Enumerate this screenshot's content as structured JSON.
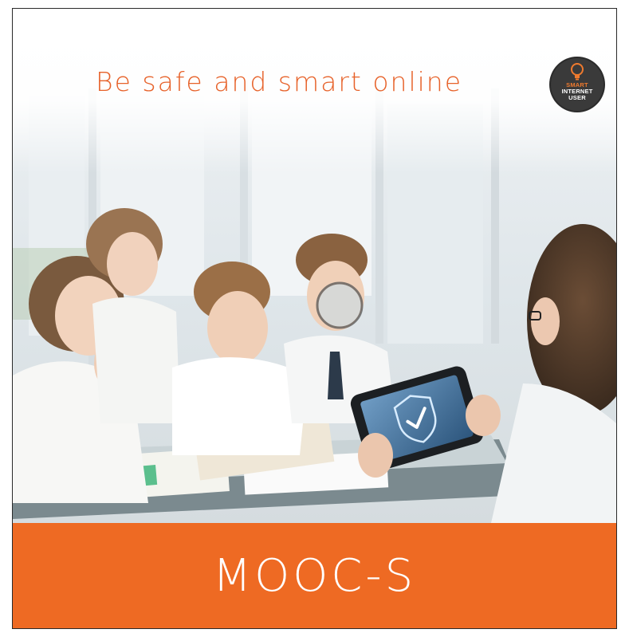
{
  "cover": {
    "headline": "Be safe and smart online",
    "badge": {
      "line1": "SMART",
      "line2": "INTERNET",
      "line3": "USER"
    },
    "brand": "MOOC-S"
  },
  "photo": {
    "subject": "Children gathered around a table looking at a tablet held by a teacher showing a shield with a check mark",
    "tablet_icon": "shield-check-icon"
  },
  "colors": {
    "accent": "#ee6a23",
    "headline": "#e7622a",
    "badge_bg": "#3a3a3a",
    "tablet_screen": "#3f6d96"
  }
}
